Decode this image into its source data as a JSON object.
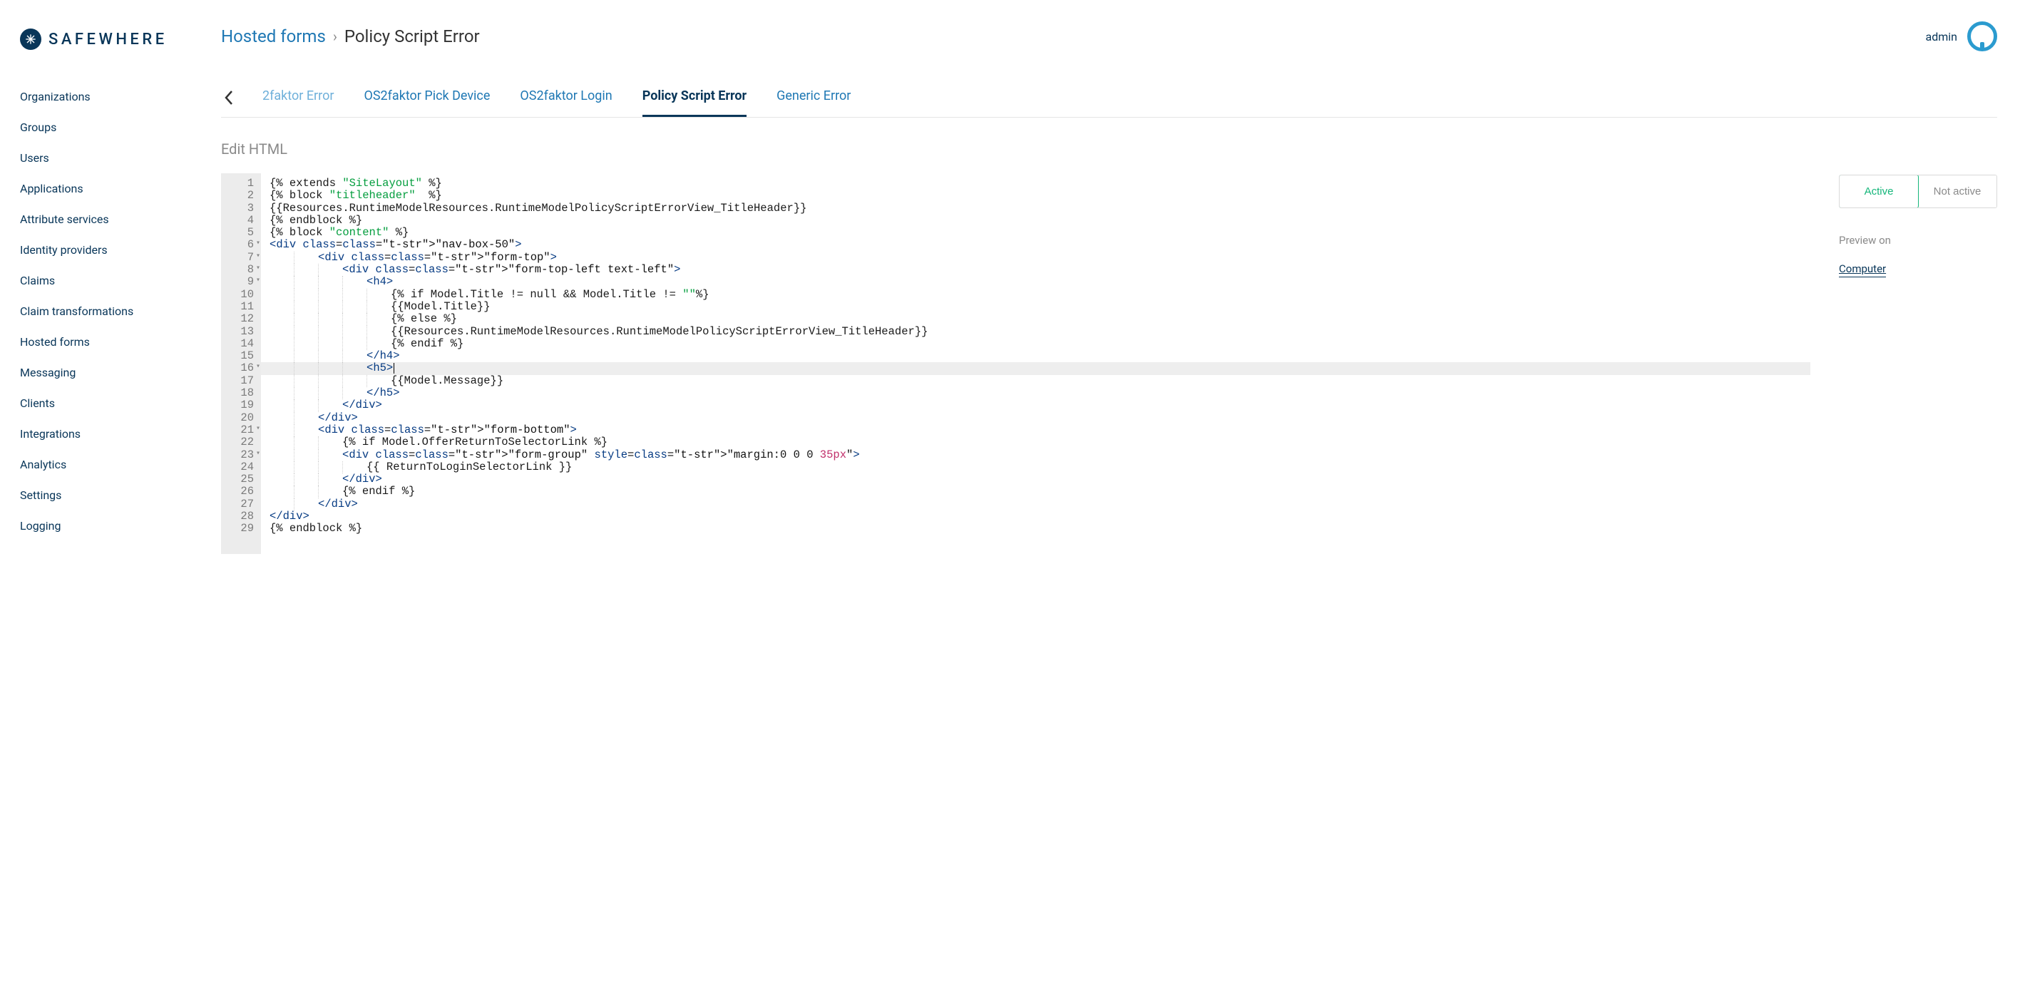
{
  "brand": {
    "name": "SAFEWHERE"
  },
  "user": {
    "name": "admin"
  },
  "breadcrumb": {
    "root": "Hosted forms",
    "sep": "›",
    "current": "Policy Script Error"
  },
  "sidebar": {
    "items": [
      {
        "label": "Organizations"
      },
      {
        "label": "Groups"
      },
      {
        "label": "Users"
      },
      {
        "label": "Applications"
      },
      {
        "label": "Attribute services"
      },
      {
        "label": "Identity providers"
      },
      {
        "label": "Claims"
      },
      {
        "label": "Claim transformations"
      },
      {
        "label": "Hosted forms"
      },
      {
        "label": "Messaging"
      },
      {
        "label": "Clients"
      },
      {
        "label": "Integrations"
      },
      {
        "label": "Analytics"
      },
      {
        "label": "Settings"
      },
      {
        "label": "Logging"
      }
    ]
  },
  "tabs": [
    {
      "label": "2faktor Error",
      "active": false,
      "cut": true
    },
    {
      "label": "OS2faktor Pick Device",
      "active": false,
      "cut": false
    },
    {
      "label": "OS2faktor Login",
      "active": false,
      "cut": false
    },
    {
      "label": "Policy Script Error",
      "active": true,
      "cut": false
    },
    {
      "label": "Generic Error",
      "active": false,
      "cut": false
    }
  ],
  "subhead": "Edit HTML",
  "toggle": {
    "active": "Active",
    "inactive": "Not active"
  },
  "preview": {
    "label": "Preview on",
    "link": "Computer"
  },
  "editor": {
    "line_numbers": [
      "1",
      "2",
      "3",
      "4",
      "5",
      "6",
      "7",
      "8",
      "9",
      "10",
      "11",
      "12",
      "13",
      "14",
      "15",
      "16",
      "17",
      "18",
      "19",
      "20",
      "21",
      "22",
      "23",
      "24",
      "25",
      "26",
      "27",
      "28",
      "29"
    ],
    "fold_rows": [
      6,
      7,
      8,
      9,
      16,
      21,
      23
    ],
    "highlighted_row": 16,
    "source_plain": "{% extends \"SiteLayout\" %}\n{% block \"titleheader\"  %}\n{{Resources.RuntimeModelResources.RuntimeModelPolicyScriptErrorView_TitleHeader}}\n{% endblock %}\n{% block \"content\" %}\n<div class=\"nav-box-50\">\n        <div class=\"form-top\">\n            <div class=\"form-top-left text-left\">\n                <h4>\n                    {% if Model.Title != null && Model.Title != \"\"%}\n                    {{Model.Title}}\n                    {% else %}\n                    {{Resources.RuntimeModelResources.RuntimeModelPolicyScriptErrorView_TitleHeader}}\n                    {% endif %}\n                </h4>\n                <h5>\n                    {{Model.Message}}\n                </h5>\n            </div>\n        </div>\n        <div class=\"form-bottom\">\n            {% if Model.OfferReturnToSelectorLink %}\n            <div class=\"form-group\" style=\"margin:0 0 0 35px\">\n                {{ ReturnToLoginSelectorLink }}\n            </div>\n            {% endif %}\n        </div>\n</div>\n{% endblock %}"
  }
}
